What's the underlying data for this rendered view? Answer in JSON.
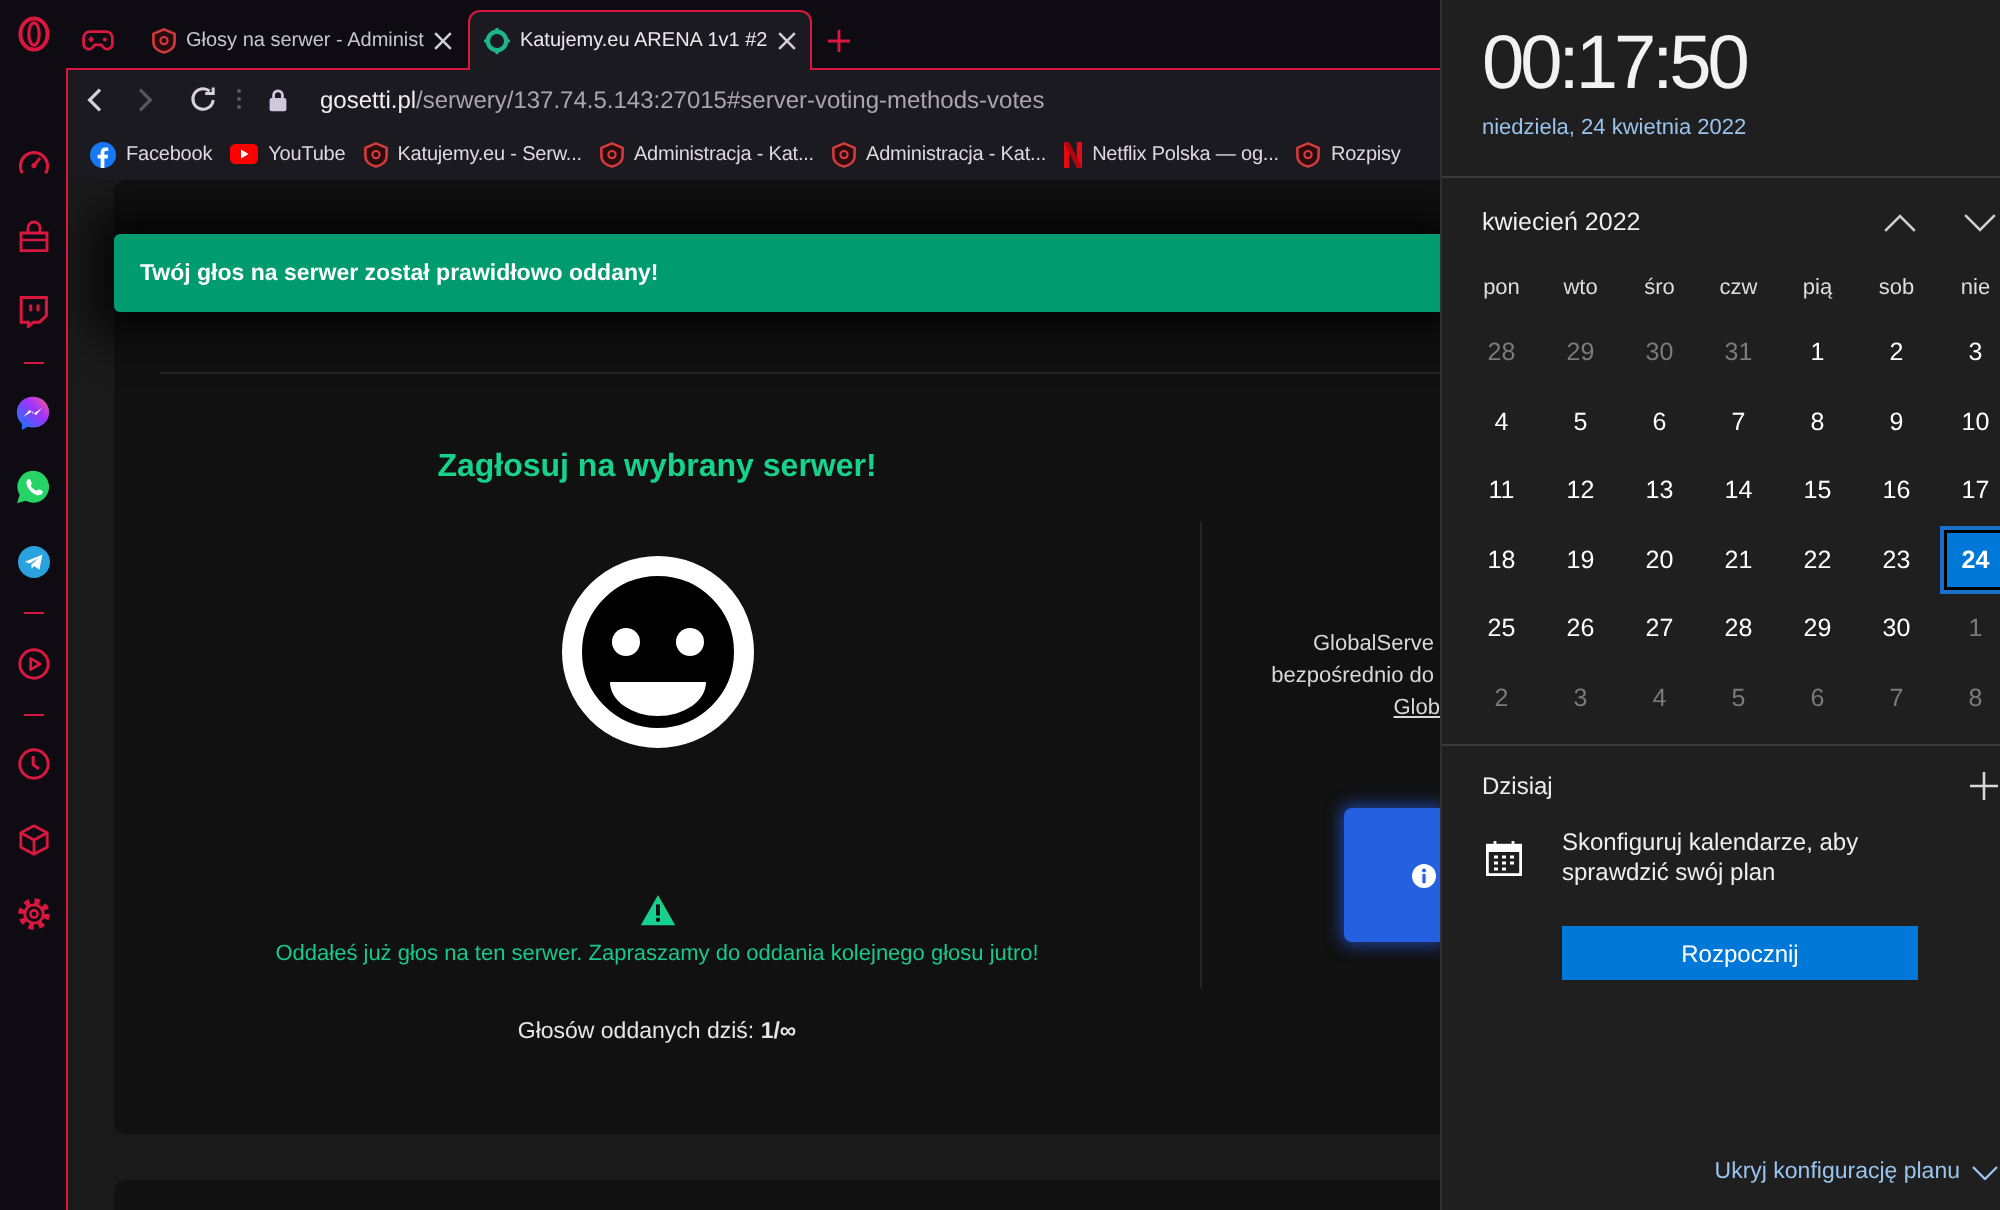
{
  "browser": {
    "tabs": [
      {
        "title": "Głosy na serwer - Administ",
        "kind": "shield",
        "selected": false
      },
      {
        "title": "Katujemy.eu ARENA 1v1 #2",
        "kind": "ring",
        "selected": true
      }
    ],
    "toolbar": {
      "back": {
        "disabled": false
      },
      "forward": {
        "disabled": true
      },
      "address": {
        "host": "gosetti.pl",
        "path": "/serwery/137.74.5.143:27015#server-voting-methods-votes"
      }
    },
    "bookmarks": [
      {
        "label": "Facebook",
        "kind": "facebook"
      },
      {
        "label": "YouTube",
        "kind": "youtube"
      },
      {
        "label": "Katujemy.eu - Serw...",
        "kind": "shield"
      },
      {
        "label": "Administracja - Kat...",
        "kind": "shield"
      },
      {
        "label": "Administracja - Kat...",
        "kind": "shield"
      },
      {
        "label": "Netflix Polska — og...",
        "kind": "netflix"
      },
      {
        "label": "Rozpisy",
        "kind": "shield"
      }
    ]
  },
  "page": {
    "toast": "Twój głos na serwer został prawidłowo oddany!",
    "heading": "Zagłosuj na wybrany serwer!",
    "notice": "Oddałeś już głos na ten serwer. Zapraszamy do oddania kolejnego głosu jutro!",
    "votes_today": "Głosów oddanych dziś: **1/∞**",
    "side_lines": [
      "GlobalServe",
      "bezpośrednio do"
    ],
    "side_link": "Glob"
  },
  "clock_flyout": {
    "time": "00:17:50",
    "date": "niedziela, 24 kwietnia 2022",
    "month": "kwiecień 2022",
    "weekdays": [
      "pon",
      "wto",
      "śro",
      "czw",
      "pią",
      "sob",
      "nie"
    ],
    "days": [
      {
        "day": "28",
        "in_month": false,
        "selected": false
      },
      {
        "day": "29",
        "in_month": false,
        "selected": false
      },
      {
        "day": "30",
        "in_month": false,
        "selected": false
      },
      {
        "day": "31",
        "in_month": false,
        "selected": false
      },
      {
        "day": "1",
        "in_month": true,
        "selected": false
      },
      {
        "day": "2",
        "in_month": true,
        "selected": false
      },
      {
        "day": "3",
        "in_month": true,
        "selected": false
      },
      {
        "day": "4",
        "in_month": true,
        "selected": false
      },
      {
        "day": "5",
        "in_month": true,
        "selected": false
      },
      {
        "day": "6",
        "in_month": true,
        "selected": false
      },
      {
        "day": "7",
        "in_month": true,
        "selected": false
      },
      {
        "day": "8",
        "in_month": true,
        "selected": false
      },
      {
        "day": "9",
        "in_month": true,
        "selected": false
      },
      {
        "day": "10",
        "in_month": true,
        "selected": false
      },
      {
        "day": "11",
        "in_month": true,
        "selected": false
      },
      {
        "day": "12",
        "in_month": true,
        "selected": false
      },
      {
        "day": "13",
        "in_month": true,
        "selected": false
      },
      {
        "day": "14",
        "in_month": true,
        "selected": false
      },
      {
        "day": "15",
        "in_month": true,
        "selected": false
      },
      {
        "day": "16",
        "in_month": true,
        "selected": false
      },
      {
        "day": "17",
        "in_month": true,
        "selected": false
      },
      {
        "day": "18",
        "in_month": true,
        "selected": false
      },
      {
        "day": "19",
        "in_month": true,
        "selected": false
      },
      {
        "day": "20",
        "in_month": true,
        "selected": false
      },
      {
        "day": "21",
        "in_month": true,
        "selected": false
      },
      {
        "day": "22",
        "in_month": true,
        "selected": false
      },
      {
        "day": "23",
        "in_month": true,
        "selected": false
      },
      {
        "day": "24",
        "in_month": true,
        "selected": true
      },
      {
        "day": "25",
        "in_month": true,
        "selected": false
      },
      {
        "day": "26",
        "in_month": true,
        "selected": false
      },
      {
        "day": "27",
        "in_month": true,
        "selected": false
      },
      {
        "day": "28",
        "in_month": true,
        "selected": false
      },
      {
        "day": "29",
        "in_month": true,
        "selected": false
      },
      {
        "day": "30",
        "in_month": true,
        "selected": false
      },
      {
        "day": "1",
        "in_month": false,
        "selected": false
      },
      {
        "day": "2",
        "in_month": false,
        "selected": false
      },
      {
        "day": "3",
        "in_month": false,
        "selected": false
      },
      {
        "day": "4",
        "in_month": false,
        "selected": false
      },
      {
        "day": "5",
        "in_month": false,
        "selected": false
      },
      {
        "day": "6",
        "in_month": false,
        "selected": false
      },
      {
        "day": "7",
        "in_month": false,
        "selected": false
      },
      {
        "day": "8",
        "in_month": false,
        "selected": false
      }
    ],
    "agenda_title": "Dzisiaj",
    "agenda_message": "Skonfiguruj kalendarze, aby sprawdzić swój plan",
    "start_button": "Rozpocznij",
    "footer_link": "Ukryj konfigurację planu"
  }
}
